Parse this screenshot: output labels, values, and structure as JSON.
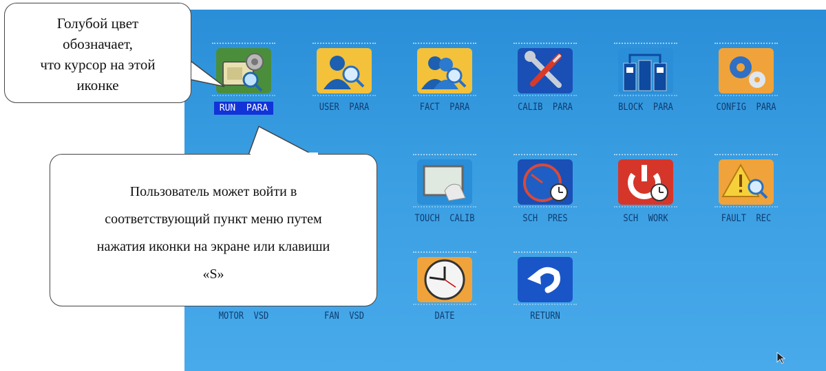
{
  "callouts": {
    "cursor_hint": [
      "Голубой цвет",
      "обозначает,",
      "что курсор на этой",
      "иконке"
    ],
    "usage_hint": [
      "Пользователь может войти в",
      "соответствующий пункт меню путем",
      "нажатия иконки на экране или клавиши",
      "«S»"
    ]
  },
  "menu": {
    "row1": [
      {
        "label": "RUN  PARA",
        "icon": "run-param-icon",
        "selected": true
      },
      {
        "label": "USER  PARA",
        "icon": "user-param-icon"
      },
      {
        "label": "FACT  PARA",
        "icon": "factory-param-icon"
      },
      {
        "label": "CALIB  PARA",
        "icon": "calibration-tools-icon"
      },
      {
        "label": "BLOCK  PARA",
        "icon": "block-param-icon"
      },
      {
        "label": "CONFIG  PARA",
        "icon": "config-gears-icon"
      }
    ],
    "row2": [
      {
        "label": "TOUCH  CALIB",
        "icon": "touch-calib-icon"
      },
      {
        "label": "SCH  PRES",
        "icon": "schedule-pressure-icon"
      },
      {
        "label": "SCH  WORK",
        "icon": "schedule-work-icon"
      },
      {
        "label": "FAULT  REC",
        "icon": "fault-record-icon"
      }
    ],
    "row3": [
      {
        "label": "MOTOR  VSD"
      },
      {
        "label": "FAN  VSD"
      },
      {
        "label": "DATE",
        "icon": "clock-icon"
      },
      {
        "label": "RETURN",
        "icon": "return-arrow-icon"
      }
    ]
  },
  "colors": {
    "screen": "#2a8ed8",
    "selected": "#1133d8"
  }
}
